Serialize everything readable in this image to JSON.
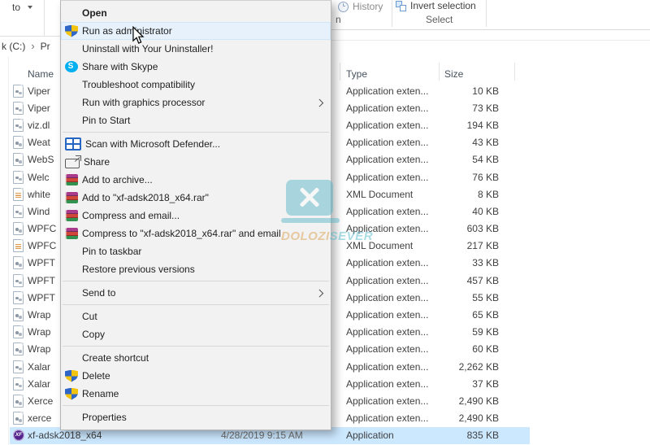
{
  "ribbon": {
    "to_button_label": "to",
    "open_group_label_fragment": "n",
    "history_label": "History",
    "invert_selection_label": "Invert selection",
    "select_group_label": "Select"
  },
  "breadcrumb": {
    "path_fragment": "k (C:)",
    "chevron": "›",
    "next_fragment": "Pr"
  },
  "file_list": {
    "columns": [
      "Name",
      "Type",
      "Size"
    ],
    "rows": [
      {
        "name": "Viper",
        "type": "Application exten...",
        "size": "10 KB",
        "icon": "dllfile"
      },
      {
        "name": "Viper",
        "type": "Application exten...",
        "size": "73 KB",
        "icon": "dllfile"
      },
      {
        "name": "viz.dl",
        "type": "Application exten...",
        "size": "194 KB",
        "icon": "dllfile"
      },
      {
        "name": "Weat",
        "type": "Application exten...",
        "size": "43 KB",
        "icon": "dllfile"
      },
      {
        "name": "WebS",
        "type": "Application exten...",
        "size": "54 KB",
        "icon": "dllfile"
      },
      {
        "name": "Welc",
        "type": "Application exten...",
        "size": "76 KB",
        "icon": "dllfile"
      },
      {
        "name": "white",
        "type": "XML Document",
        "size": "8 KB",
        "icon": "xmlfile"
      },
      {
        "name": "Wind",
        "type": "Application exten...",
        "size": "40 KB",
        "icon": "dllfile"
      },
      {
        "name": "WPFC",
        "type": "Application exten...",
        "size": "603 KB",
        "icon": "dllfile"
      },
      {
        "name": "WPFC",
        "type": "XML Document",
        "size": "217 KB",
        "icon": "xmlfile"
      },
      {
        "name": "WPFT",
        "type": "Application exten...",
        "size": "33 KB",
        "icon": "dllfile"
      },
      {
        "name": "WPFT",
        "type": "Application exten...",
        "size": "457 KB",
        "icon": "dllfile"
      },
      {
        "name": "WPFT",
        "type": "Application exten...",
        "size": "55 KB",
        "icon": "dllfile"
      },
      {
        "name": "Wrap",
        "type": "Application exten...",
        "size": "65 KB",
        "icon": "dllfile"
      },
      {
        "name": "Wrap",
        "type": "Application exten...",
        "size": "59 KB",
        "icon": "dllfile"
      },
      {
        "name": "Wrap",
        "type": "Application exten...",
        "size": "60 KB",
        "icon": "dllfile"
      },
      {
        "name": "Xalar",
        "type": "Application exten...",
        "size": "2,262 KB",
        "icon": "dllfile"
      },
      {
        "name": "Xalar",
        "type": "Application exten...",
        "size": "37 KB",
        "icon": "dllfile"
      },
      {
        "name": "Xerce",
        "type": "Application exten...",
        "size": "2,490 KB",
        "icon": "dllfile"
      },
      {
        "name": "xerce",
        "type": "Application exten...",
        "size": "2,490 KB",
        "icon": "dllfile"
      },
      {
        "name": "xf-adsk2018_x64",
        "type": "Application",
        "size": "835 KB",
        "icon": "xf",
        "selected": true,
        "date_modified": "4/28/2019 9:15 AM"
      }
    ]
  },
  "context_menu": {
    "items": [
      {
        "label": "Open",
        "bold": true
      },
      {
        "label": "Run as administrator",
        "icon": "shield",
        "highlighted": true
      },
      {
        "label": "Uninstall with Your Uninstaller!"
      },
      {
        "label": "Share with Skype",
        "icon": "skype"
      },
      {
        "label": "Troubleshoot compatibility"
      },
      {
        "label": "Run with graphics processor",
        "has_submenu": true
      },
      {
        "label": "Pin to Start"
      },
      {
        "type": "separator"
      },
      {
        "label": "Scan with Microsoft Defender...",
        "icon": "defender"
      },
      {
        "label": "Share",
        "icon": "share"
      },
      {
        "label": "Add to archive...",
        "icon": "winrar"
      },
      {
        "label": "Add to \"xf-adsk2018_x64.rar\"",
        "icon": "winrar"
      },
      {
        "label": "Compress and email...",
        "icon": "winrar"
      },
      {
        "label": "Compress to \"xf-adsk2018_x64.rar\" and email",
        "icon": "winrar"
      },
      {
        "label": "Pin to taskbar"
      },
      {
        "label": "Restore previous versions"
      },
      {
        "type": "separator"
      },
      {
        "label": "Send to",
        "has_submenu": true
      },
      {
        "type": "separator"
      },
      {
        "label": "Cut"
      },
      {
        "label": "Copy"
      },
      {
        "type": "separator"
      },
      {
        "label": "Create shortcut"
      },
      {
        "label": "Delete",
        "icon": "shield"
      },
      {
        "label": "Rename",
        "icon": "shield"
      },
      {
        "type": "separator"
      },
      {
        "label": "Properties"
      }
    ]
  },
  "watermark": {
    "brand_primary": "DOLOZI",
    "brand_secondary": "SEVER"
  },
  "colors": {
    "selection_blue": "#cce8ff",
    "menu_highlight": "#e6f1fb",
    "uac_blue": "#2d66c6",
    "uac_yellow": "#f2c410",
    "skype_blue": "#00aff0",
    "watermark_teal": "#4fb2c4",
    "watermark_orange": "#d9973c"
  }
}
